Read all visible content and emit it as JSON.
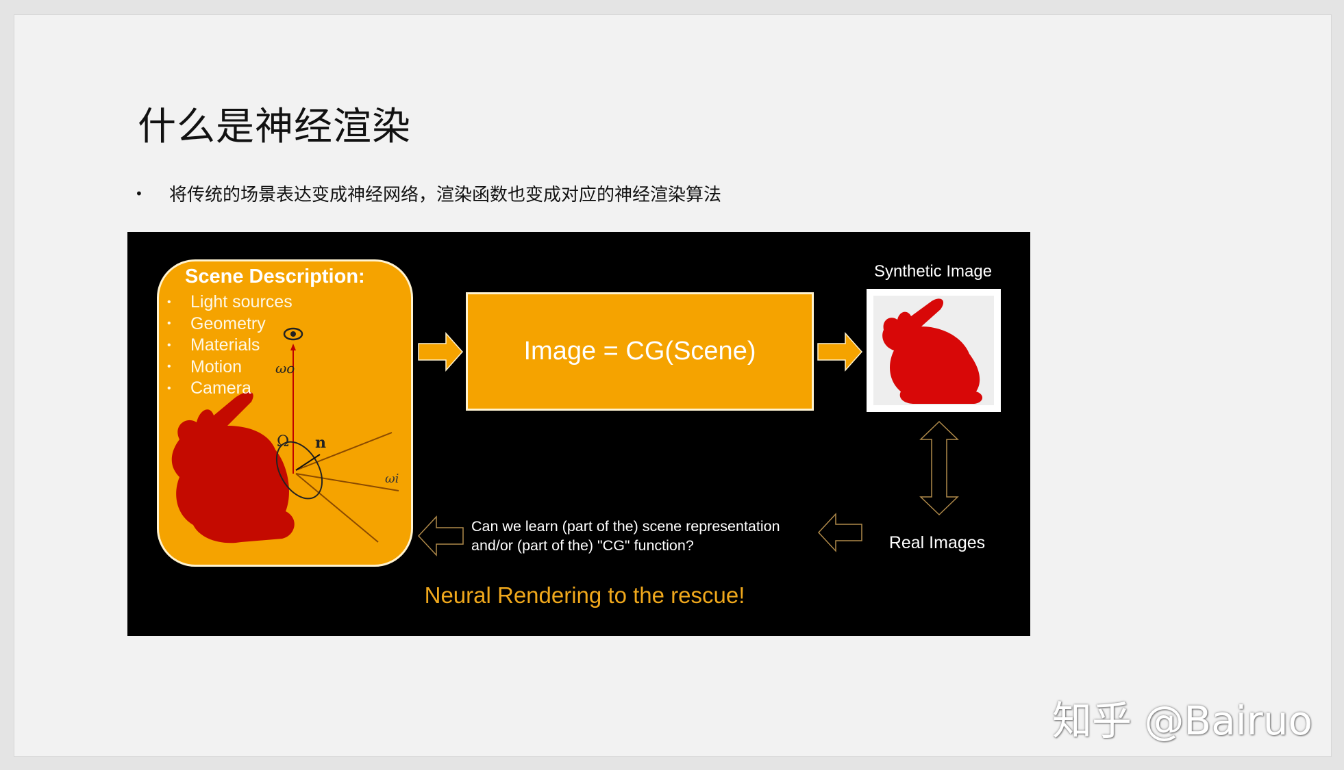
{
  "slide": {
    "title": "什么是神经渲染",
    "bullet": "将传统的场景表达变成神经网络，渲染函数也变成对应的神经渲染算法"
  },
  "figure": {
    "scene_title": "Scene Description:",
    "scene_items": [
      "Light sources",
      "Geometry",
      "Materials",
      "Motion",
      "Camera"
    ],
    "math_labels": {
      "omega_o": "ωo",
      "omega_i": "ωi",
      "Omega": "Ω",
      "n": "n"
    },
    "formula": "Image = CG(Scene)",
    "synthetic_label": "Synthetic Image",
    "real_label": "Real Images",
    "question": [
      "Can we learn (part of the) scene representation",
      "and/or (part of the) \"CG\" function?"
    ],
    "rescue": "Neural Rendering to the rescue!",
    "colors": {
      "accent": "#f5a300",
      "rescue_text": "#f0a81c",
      "bunny": "#c00000",
      "background": "#000000"
    }
  },
  "watermark": "知乎 @Bairuo"
}
